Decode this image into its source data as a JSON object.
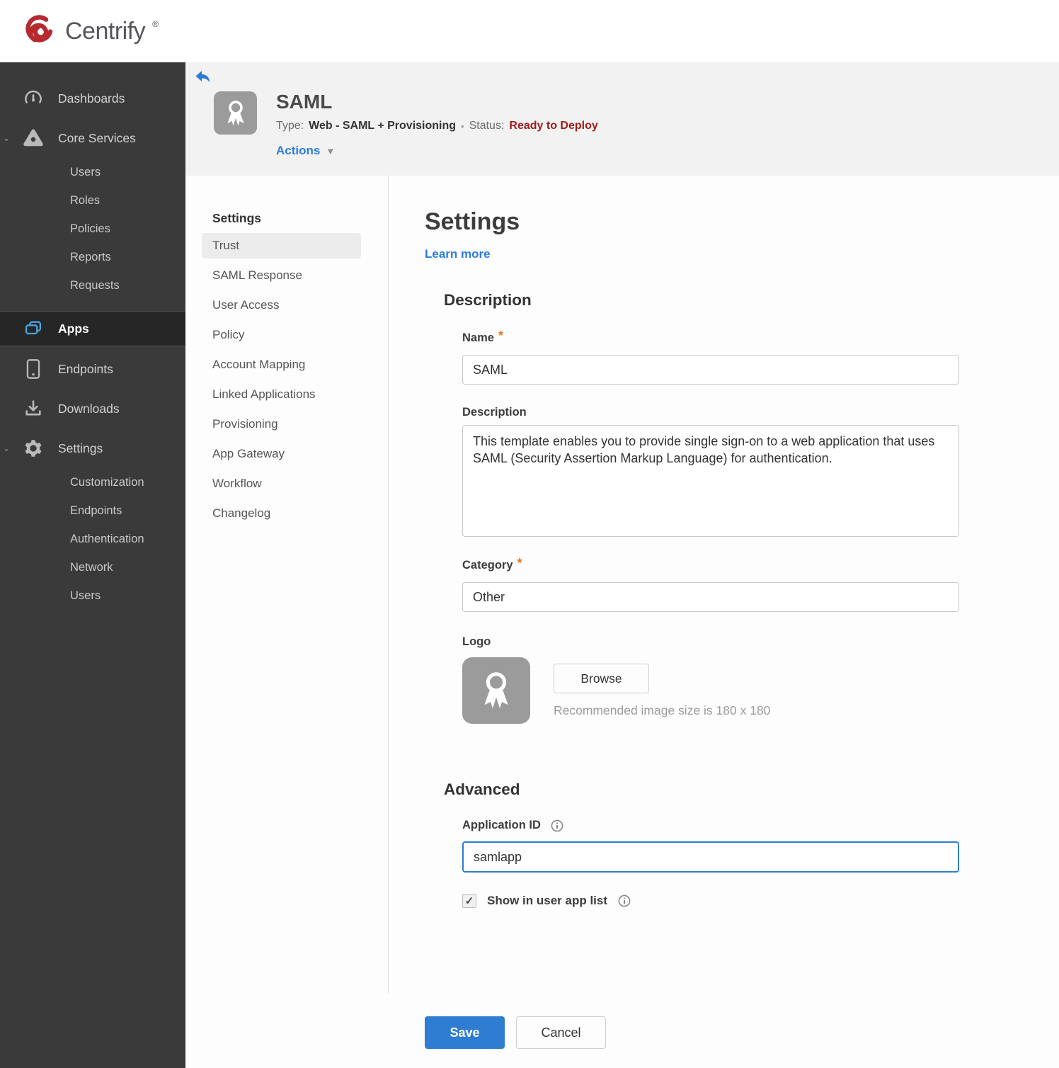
{
  "brand": {
    "name": "Centrify",
    "reg_mark": "®",
    "logo_color": "#b5292f"
  },
  "icons": {
    "check": "✓",
    "dropdown_caret": "▼",
    "bullet": "•",
    "chevron_expanded": "⌄",
    "asterisk": "*"
  },
  "sidebar": {
    "dashboards": "Dashboards",
    "core_services": "Core Services",
    "core_children": [
      "Users",
      "Roles",
      "Policies",
      "Reports",
      "Requests"
    ],
    "apps": "Apps",
    "endpoints": "Endpoints",
    "downloads": "Downloads",
    "settings": "Settings",
    "settings_children": [
      "Customization",
      "Endpoints",
      "Authentication",
      "Network",
      "Users"
    ]
  },
  "app_header": {
    "title": "SAML",
    "type_label": "Type:",
    "type_value": "Web - SAML + Provisioning",
    "status_label": "Status:",
    "status_value": "Ready to Deploy",
    "actions_label": "Actions"
  },
  "settings_nav": {
    "heading": "Settings",
    "items": [
      "Trust",
      "SAML Response",
      "User Access",
      "Policy",
      "Account Mapping",
      "Linked Applications",
      "Provisioning",
      "App Gateway",
      "Workflow",
      "Changelog"
    ],
    "selected": "Trust"
  },
  "panel": {
    "heading": "Settings",
    "learn_more": "Learn more",
    "description_section": {
      "heading": "Description",
      "name_label": "Name",
      "name_value": "SAML",
      "description_label": "Description",
      "description_value": "This template enables you to provide single sign-on to a web application that uses SAML (Security Assertion Markup Language) for authentication.",
      "category_label": "Category",
      "category_value": "Other",
      "logo_label": "Logo",
      "browse_label": "Browse",
      "logo_hint": "Recommended image size is 180 x 180"
    },
    "advanced_section": {
      "heading": "Advanced",
      "app_id_label": "Application ID",
      "app_id_value": "samlapp",
      "checkbox_label": "Show in user app list",
      "checkbox_checked": true
    },
    "save_label": "Save",
    "cancel_label": "Cancel"
  },
  "colors": {
    "accent_blue": "#2b7ce0",
    "save_blue": "#2e7dd2",
    "status_red": "#a01d1d",
    "required_orange": "#e8742b",
    "sidebar_bg": "#3a3a3a",
    "header_bg": "#f2f2f2",
    "apps_icon_blue": "#4aa3df"
  }
}
